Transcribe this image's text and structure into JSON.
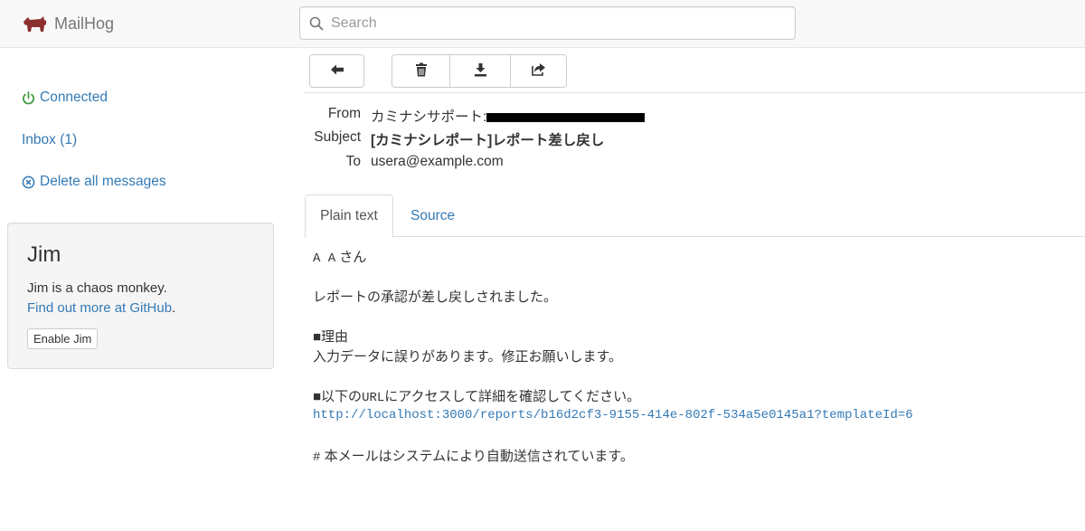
{
  "app": {
    "brand_name": "MailHog",
    "brand_color": "#8b2e2e",
    "accent_color": "#337ab7",
    "connected_color": "#3c9a3c"
  },
  "search": {
    "placeholder": "Search",
    "value": ""
  },
  "sidebar": {
    "connected_label": "Connected",
    "inbox_label": "Inbox (1)",
    "delete_all_label": "Delete all messages"
  },
  "jim": {
    "title": "Jim",
    "description": "Jim is a chaos monkey.",
    "link_text": "Find out more at GitHub",
    "link_suffix": ".",
    "button_label": "Enable Jim"
  },
  "toolbar": {
    "back_icon": "arrow-left-icon",
    "delete_icon": "trash-icon",
    "download_icon": "download-icon",
    "release_icon": "share-icon"
  },
  "message": {
    "from_label": "From",
    "from_value": "カミナシサポート:",
    "subject_label": "Subject",
    "subject_value": "[カミナシレポート]レポート差し戻し",
    "to_label": "To",
    "to_value": "usera@example.com"
  },
  "tabs": [
    {
      "label": "Plain text",
      "active": true
    },
    {
      "label": "Source",
      "active": false
    }
  ],
  "body": {
    "greeting_prefix": "A A",
    "greeting_suffix": " さん",
    "line_1": "レポートの承認が差し戻しされました。",
    "reason_heading": "■理由",
    "reason_text": "入力データに誤りがあります。修正お願いします。",
    "access_prefix": "■以下の",
    "access_url_word": "URL",
    "access_suffix": "にアクセスして詳細を確認してください。",
    "url": "http://localhost:3000/reports/b16d2cf3-9155-414e-802f-534a5e0145a1?templateId=6",
    "footer_hash": "#",
    "footer_text": " 本メールはシステムにより自動送信されています。"
  }
}
